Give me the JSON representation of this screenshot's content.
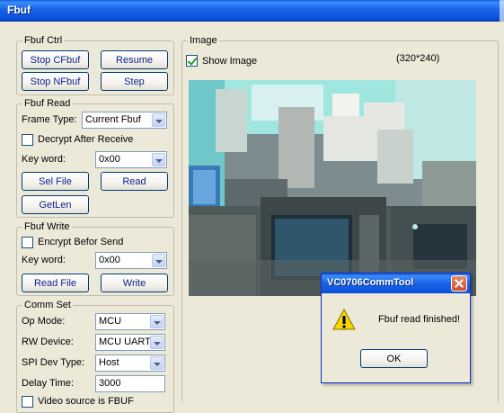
{
  "window": {
    "title": "Fbuf"
  },
  "fbuf_ctrl": {
    "legend": "Fbuf Ctrl",
    "stop_cfbuf": "Stop CFbuf",
    "resume": "Resume",
    "stop_nfbuf": "Stop NFbuf",
    "step": "Step"
  },
  "fbuf_read": {
    "legend": "Fbuf Read",
    "frame_type_label": "Frame Type:",
    "frame_type_value": "Current Fbuf",
    "decrypt_label": "Decrypt After Receive",
    "decrypt_checked": false,
    "keyword_label": "Key word:",
    "keyword_value": "0x00",
    "sel_file": "Sel File",
    "read": "Read",
    "getlen": "GetLen"
  },
  "fbuf_write": {
    "legend": "Fbuf Write",
    "encrypt_label": "Encrypt Befor Send",
    "encrypt_checked": false,
    "keyword_label": "Key word:",
    "keyword_value": "0x00",
    "read_file": "Read File",
    "write": "Write"
  },
  "comm_set": {
    "legend": "Comm Set",
    "op_mode_label": "Op Mode:",
    "op_mode_value": "MCU",
    "rw_device_label": "RW Device:",
    "rw_device_value": "MCU UART",
    "spi_dev_type_label": "SPI Dev Type:",
    "spi_dev_type_value": "Host",
    "delay_time_label": "Delay Time:",
    "delay_time_value": "3000",
    "video_source_label": "Video source is FBUF"
  },
  "image": {
    "legend": "Image",
    "show_image_label": "Show Image",
    "show_image_checked": true,
    "resolution": "(320*240)"
  },
  "dialog": {
    "title": "VC0706CommTool",
    "message": "Fbuf read finished!",
    "ok": "OK"
  }
}
